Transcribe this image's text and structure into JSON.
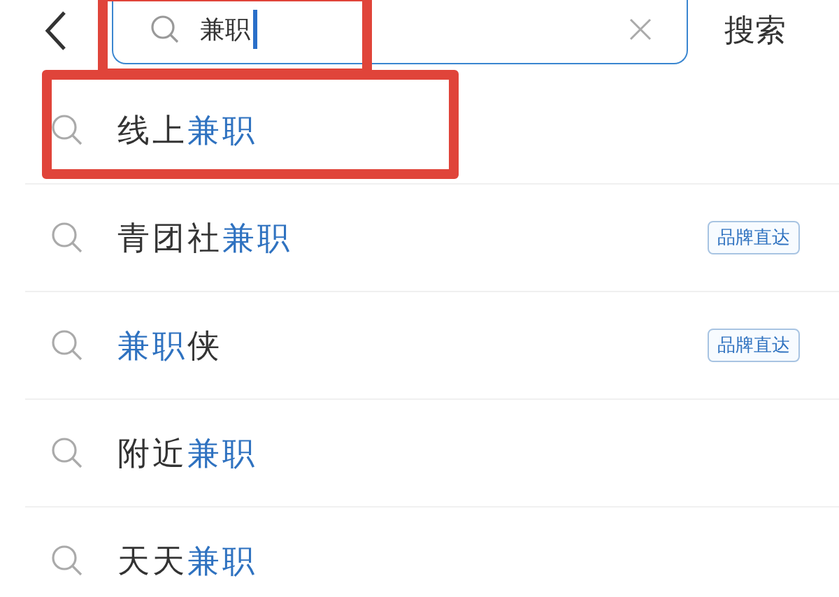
{
  "search": {
    "value": "兼职",
    "highlighted": true,
    "submit_label": "搜索"
  },
  "suggestions": [
    {
      "before": "线上",
      "match": "兼职",
      "highlighted": true
    },
    {
      "before": "青团社",
      "match": "兼职",
      "badge": "品牌直达",
      "highlighted": false
    },
    {
      "match": "兼职",
      "after": "侠",
      "badge": "品牌直达",
      "highlighted": false
    },
    {
      "before": "附近",
      "match": "兼职",
      "highlighted": false
    },
    {
      "before": "天天",
      "match": "兼职",
      "highlighted": false
    }
  ]
}
